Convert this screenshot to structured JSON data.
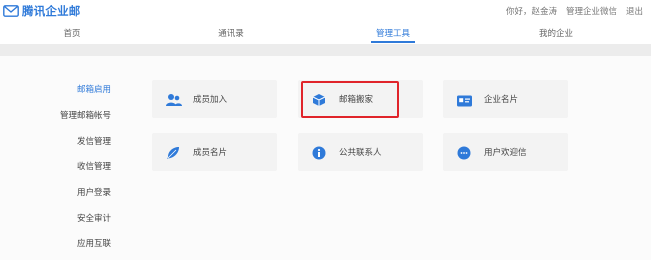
{
  "app": {
    "title": "腾讯企业邮"
  },
  "user_links": [
    "你好，赵金涛",
    "管理企业微信",
    "退出"
  ],
  "nav": {
    "tabs": [
      {
        "label": "首页",
        "active": false
      },
      {
        "label": "通讯录",
        "active": false
      },
      {
        "label": "管理工具",
        "active": true
      },
      {
        "label": "我的企业",
        "active": false
      }
    ]
  },
  "sidebar": {
    "items": [
      {
        "label": "邮箱启用",
        "active": true
      },
      {
        "label": "管理邮箱帐号",
        "active": false
      },
      {
        "label": "发信管理",
        "active": false
      },
      {
        "label": "收信管理",
        "active": false
      },
      {
        "label": "用户登录",
        "active": false
      },
      {
        "label": "安全审计",
        "active": false
      },
      {
        "label": "应用互联",
        "active": false
      }
    ]
  },
  "tools": [
    {
      "label": "成员加入",
      "icon": "members-join-icon",
      "highlighted": false
    },
    {
      "label": "邮箱搬家",
      "icon": "mailbox-move-icon",
      "highlighted": true
    },
    {
      "label": "企业名片",
      "icon": "business-card-icon",
      "highlighted": false
    },
    {
      "label": "成员名片",
      "icon": "feather-icon",
      "highlighted": false
    },
    {
      "label": "公共联系人",
      "icon": "info-icon",
      "highlighted": false
    },
    {
      "label": "用户欢迎信",
      "icon": "chat-bubble-icon",
      "highlighted": false
    }
  ],
  "colors": {
    "accent": "#2f7ad9",
    "highlight": "#e0242a",
    "card_bg": "#f3f3f3",
    "band": "#ececec"
  }
}
